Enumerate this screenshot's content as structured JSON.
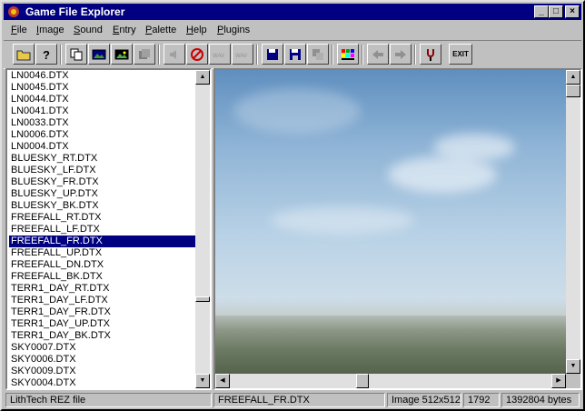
{
  "window": {
    "title": "Game File Explorer"
  },
  "menu": [
    "File",
    "Image",
    "Sound",
    "Entry",
    "Palette",
    "Help",
    "Plugins"
  ],
  "toolbar": {
    "buttons": [
      "open-folder",
      "help",
      "copy",
      "view-image",
      "export-image",
      "pages-disabled",
      "sound-disabled",
      "no-sound",
      "wav-disabled",
      "wav2-disabled",
      "save",
      "save-as",
      "save-multiple",
      "palette",
      "back-disabled",
      "forward-disabled",
      "plugin"
    ],
    "exit_label": "EXIT"
  },
  "file_list": {
    "items": [
      "LN0046.DTX",
      "LN0045.DTX",
      "LN0044.DTX",
      "LN0041.DTX",
      "LN0033.DTX",
      "LN0006.DTX",
      "LN0004.DTX",
      "BLUESKY_RT.DTX",
      "BLUESKY_LF.DTX",
      "BLUESKY_FR.DTX",
      "BLUESKY_UP.DTX",
      "BLUESKY_BK.DTX",
      "FREEFALL_RT.DTX",
      "FREEFALL_LF.DTX",
      "FREEFALL_FR.DTX",
      "FREEFALL_UP.DTX",
      "FREEFALL_DN.DTX",
      "FREEFALL_BK.DTX",
      "TERR1_DAY_RT.DTX",
      "TERR1_DAY_LF.DTX",
      "TERR1_DAY_FR.DTX",
      "TERR1_DAY_UP.DTX",
      "TERR1_DAY_BK.DTX",
      "SKY0007.DTX",
      "SKY0006.DTX",
      "SKY0009.DTX",
      "SKY0004.DTX"
    ],
    "selected": "FREEFALL_FR.DTX"
  },
  "status": {
    "archive_type": "LithTech REZ file",
    "current_file": "FREEFALL_FR.DTX",
    "image_size": "Image 512x512",
    "entry_index": "1792",
    "file_size": "1392804 bytes"
  },
  "colors": {
    "titlebar": "#000080",
    "selection": "#000080",
    "face": "#c0c0c0"
  }
}
